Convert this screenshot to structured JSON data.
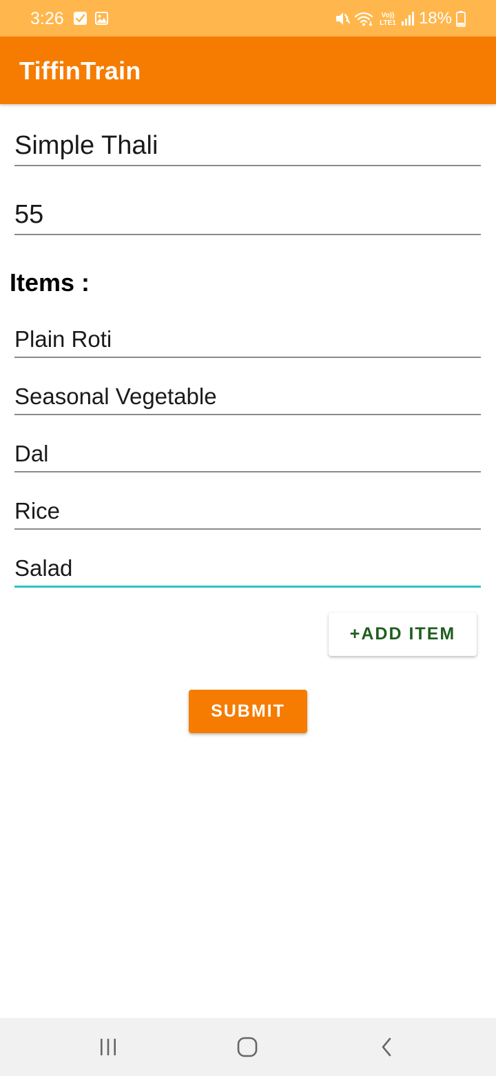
{
  "status_bar": {
    "time": "3:26",
    "battery": "18%",
    "icons": [
      "check-notification-icon",
      "image-notification-icon",
      "mute-icon",
      "wifi-icon",
      "volte-icon",
      "signal-icon",
      "battery-icon"
    ]
  },
  "app_bar": {
    "title": "TiffinTrain"
  },
  "form": {
    "name_value": "Simple Thali",
    "price_value": "55",
    "items_label": "Items :",
    "items": [
      "Plain Roti",
      "Seasonal Vegetable",
      "Dal",
      "Rice",
      "Salad"
    ],
    "add_item_label": "+ADD ITEM",
    "submit_label": "SUBMIT"
  },
  "nav_bar": {
    "icons": [
      "recents-icon",
      "home-icon",
      "back-icon"
    ]
  },
  "colors": {
    "status_bar": "#FFB74D",
    "accent": "#F57C00",
    "focus_underline": "#26C6BF",
    "add_item_text": "#1E5E1E",
    "nav_bar": "#F1F1F1"
  }
}
